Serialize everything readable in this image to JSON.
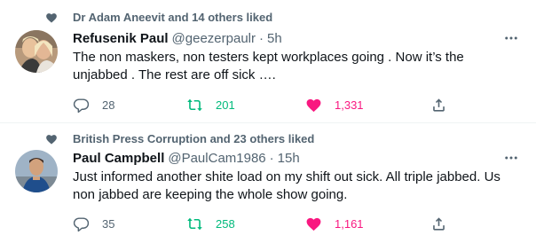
{
  "tweets": [
    {
      "social_context": "Dr Adam Aneevit and 14 others liked",
      "display_name": "Refusenik Paul",
      "handle": "@geezerpaulr",
      "separator": "·",
      "time": "5h",
      "text": "The non maskers, non testers kept workplaces going . Now it’s the unjabbed . The rest are off sick ….",
      "replies": "28",
      "retweets": "201",
      "likes": "1,331",
      "retweeted": true,
      "liked": true
    },
    {
      "social_context": "British Press Corruption and 23 others liked",
      "display_name": "Paul Campbell",
      "handle": "@PaulCam1986",
      "separator": "·",
      "time": "15h",
      "text": "Just informed another shite load on my shift out sick. All triple jabbed. Us non jabbed are keeping the whole show going.",
      "replies": "35",
      "retweets": "258",
      "likes": "1,161",
      "retweeted": true,
      "liked": true
    }
  ],
  "colors": {
    "text": "#0f1419",
    "muted": "#536471",
    "retweet": "#00ba7c",
    "like": "#f91880",
    "divider": "#eff3f4"
  },
  "icons": [
    "heart-icon",
    "more-icon",
    "reply-icon",
    "retweet-icon",
    "share-icon"
  ]
}
